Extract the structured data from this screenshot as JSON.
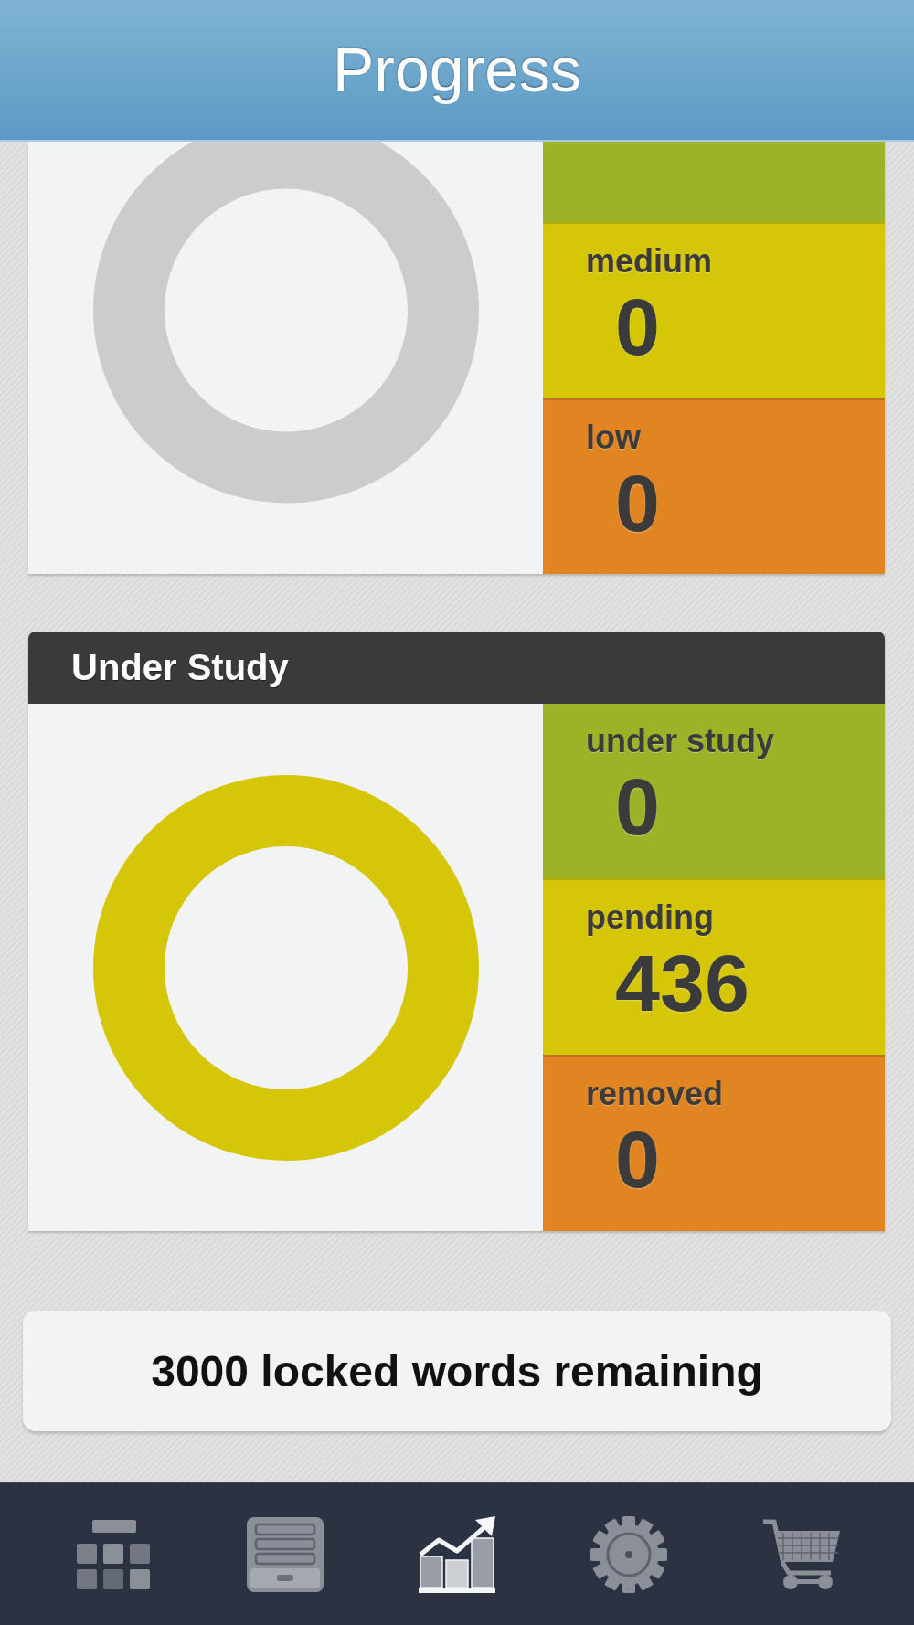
{
  "header": {
    "title": "Progress"
  },
  "cards": [
    {
      "tiles": [
        {
          "color": "#9db226"
        },
        {
          "label": "medium",
          "value": "0",
          "color": "#d6c608"
        },
        {
          "label": "low",
          "value": "0",
          "color": "#e18523"
        }
      ]
    },
    {
      "title": "Under Study",
      "tiles": [
        {
          "label": "under study",
          "value": "0",
          "color": "#9db226"
        },
        {
          "label": "pending",
          "value": "436",
          "color": "#d6c608"
        },
        {
          "label": "removed",
          "value": "0",
          "color": "#e18523"
        }
      ]
    }
  ],
  "locked_banner": {
    "text": "3000 locked words remaining"
  },
  "tab_bar": {
    "items": [
      {
        "selected": false
      },
      {
        "selected": false
      },
      {
        "selected": true
      },
      {
        "selected": false
      },
      {
        "selected": false
      }
    ]
  }
}
